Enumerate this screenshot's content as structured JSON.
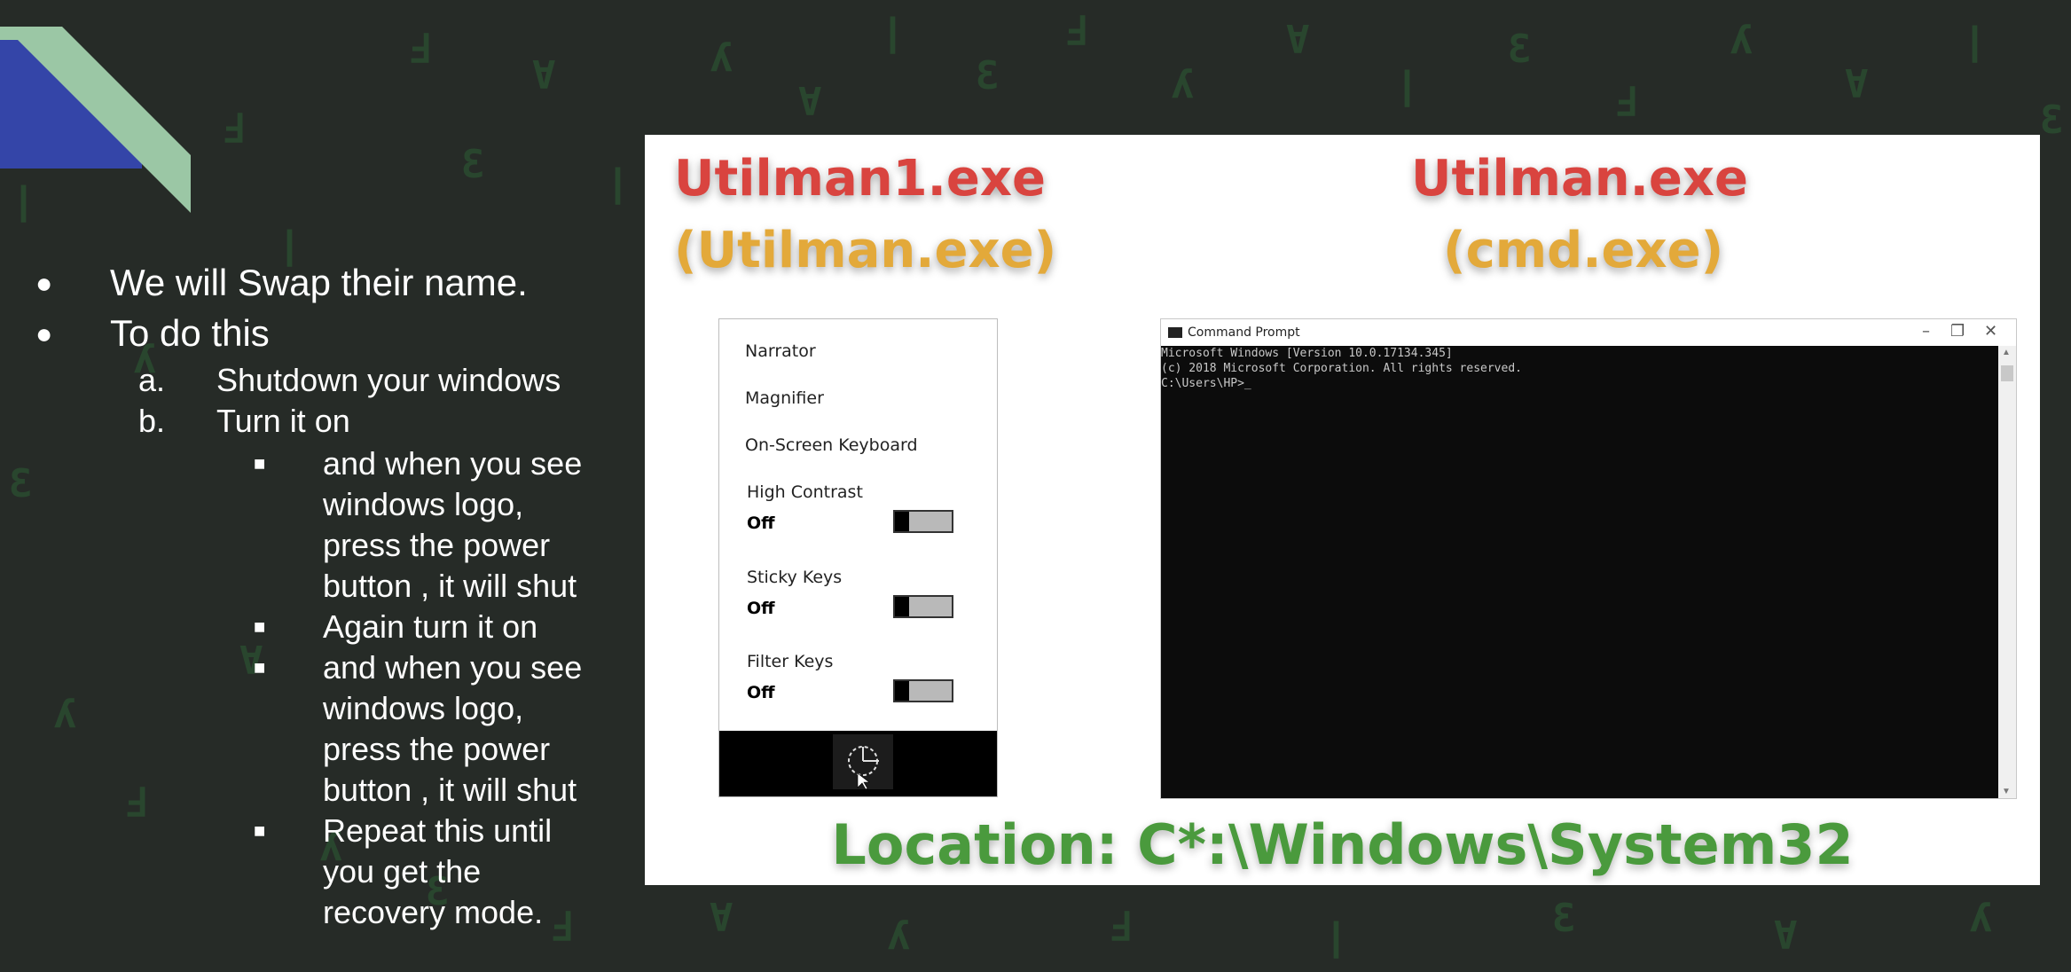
{
  "bullets": {
    "l1a": "We will Swap their name.",
    "l1b": "To do this",
    "l2a_marker": "a.",
    "l2a": "Shutdown your windows",
    "l2b_marker": "b.",
    "l2b": "Turn it on",
    "l3a": "and when you see windows logo, press the power button , it will shut",
    "l3b": "Again turn it on",
    "l3c": "and when you see windows logo, press the power button , it will shut",
    "l3d": "Repeat this until you get the recovery mode.",
    "dot": "●",
    "square": "■"
  },
  "image": {
    "left_title": "Utilman1.exe",
    "left_subtitle": "(Utilman.exe)",
    "right_title": "Utilman.exe",
    "right_subtitle": "(cmd.exe)",
    "location": "Location: C*:\\Windows\\System32",
    "ease": {
      "narrator": "Narrator",
      "magnifier": "Magnifier",
      "osk": "On-Screen Keyboard",
      "toggles": [
        {
          "label": "High Contrast",
          "state": "Off"
        },
        {
          "label": "Sticky Keys",
          "state": "Off"
        },
        {
          "label": "Filter Keys",
          "state": "Off"
        }
      ]
    },
    "cmd": {
      "title": "Command Prompt",
      "line1": "Microsoft Windows [Version 10.0.17134.345]",
      "line2": "(c) 2018 Microsoft Corporation. All rights reserved.",
      "line3": "",
      "line4": "C:\\Users\\HP>_",
      "min": "–",
      "max": "❐",
      "close": "✕"
    }
  },
  "colors": {
    "background": "#262b27",
    "accent_green": "#9bc7a5",
    "accent_blue": "#3445a8",
    "red_heading": "#d9443f",
    "yellow_heading": "#e3a93a",
    "location_green": "#4a9a3d"
  }
}
